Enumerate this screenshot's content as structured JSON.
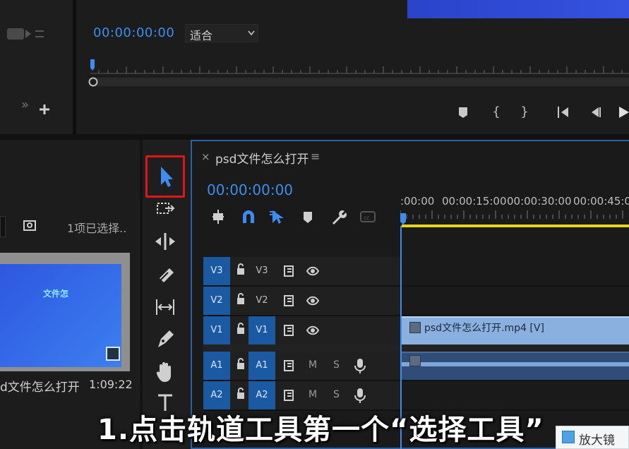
{
  "program_monitor": {
    "timecode": "00:00:00:00",
    "zoom_select": {
      "value": "适合"
    },
    "buttons": [
      "add-marker-icon",
      "mark-in-icon",
      "mark-out-icon",
      "go-to-in-icon",
      "step-back-icon",
      "play-icon"
    ],
    "left_panel_buttons": [
      "overflow-icon",
      "add-icon"
    ]
  },
  "project_panel": {
    "selection_status": "1项已选择..",
    "clip": {
      "thumbnail_text": "文件怎",
      "name": "d文件怎么打开",
      "duration": "1:09:22"
    }
  },
  "tools_panel": {
    "tools": [
      "selection-tool",
      "track-select-forward-tool",
      "ripple-edit-tool",
      "razor-tool",
      "slip-tool",
      "pen-tool",
      "hand-tool",
      "type-tool"
    ],
    "active_tool": "selection-tool",
    "highlight_color": "#e0151b"
  },
  "timeline": {
    "tab_close": "×",
    "sequence_name": "psd文件怎么打开",
    "tab_menu": "≡",
    "timecode": "00:00:00:00",
    "ruler_labels": [
      ":00:00",
      "00:00:15:00",
      "00:00:30:00",
      "00:00:45:00"
    ],
    "tracks": [
      {
        "source": "V3",
        "target": "V3",
        "target_on": false
      },
      {
        "source": "V2",
        "target": "V2",
        "target_on": false
      },
      {
        "source": "V1",
        "target": "V1",
        "target_on": true
      },
      {
        "source": "A1",
        "target": "A1",
        "target_on": true,
        "mute": "M",
        "solo": "S"
      },
      {
        "source": "A2",
        "target": "A2",
        "target_on": true,
        "mute": "M",
        "solo": "S"
      }
    ],
    "video_clip": {
      "fx": "fx",
      "name": "psd文件怎么打开.mp4 [V]"
    },
    "audio_clip": {
      "fx": "fx"
    },
    "accent_color": "#3d8cf0",
    "work_area_color": "#e6d21a"
  },
  "subtitle": "1.点击轨道工具第一个“选择工具”",
  "magnifier": {
    "label": "放大镜"
  }
}
